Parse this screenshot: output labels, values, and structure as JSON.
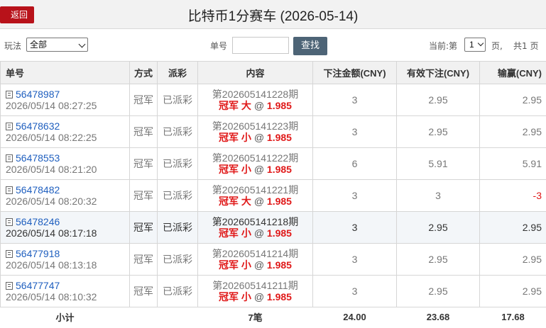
{
  "header": {
    "back_label": "返回",
    "title": "比特币1分赛车 (2026-05-14)"
  },
  "filter": {
    "play_label": "玩法",
    "play_selected": "全部",
    "order_label": "单号",
    "order_value": "",
    "search_label": "查找",
    "current_page_label": "当前:第",
    "current_page": "1",
    "page_unit": "页,",
    "total_pages": "共1 页"
  },
  "table": {
    "headers": {
      "order": "单号",
      "method": "方式",
      "payout": "派彩",
      "content": "内容",
      "bet_amount": "下注金额(CNY)",
      "valid_bet": "有效下注(CNY)",
      "win_loss": "输赢(CNY)"
    },
    "rows": [
      {
        "order_no": "56478987",
        "time": "2026/05/14 08:27:25",
        "method": "冠军",
        "payout": "已派彩",
        "issue": "第202605141228期",
        "bet": "冠军 大",
        "at": "@",
        "odds": "1.985",
        "amount": "3",
        "valid": "2.95",
        "win": "2.95"
      },
      {
        "order_no": "56478632",
        "time": "2026/05/14 08:22:25",
        "method": "冠军",
        "payout": "已派彩",
        "issue": "第202605141223期",
        "bet": "冠军 小",
        "at": "@",
        "odds": "1.985",
        "amount": "3",
        "valid": "2.95",
        "win": "2.95"
      },
      {
        "order_no": "56478553",
        "time": "2026/05/14 08:21:20",
        "method": "冠军",
        "payout": "已派彩",
        "issue": "第202605141222期",
        "bet": "冠军 小",
        "at": "@",
        "odds": "1.985",
        "amount": "6",
        "valid": "5.91",
        "win": "5.91"
      },
      {
        "order_no": "56478482",
        "time": "2026/05/14 08:20:32",
        "method": "冠军",
        "payout": "已派彩",
        "issue": "第202605141221期",
        "bet": "冠军 大",
        "at": "@",
        "odds": "1.985",
        "amount": "3",
        "valid": "3",
        "win": "-3"
      },
      {
        "order_no": "56478246",
        "time": "2026/05/14 08:17:18",
        "method": "冠军",
        "payout": "已派彩",
        "issue": "第202605141218期",
        "bet": "冠军 小",
        "at": "@",
        "odds": "1.985",
        "amount": "3",
        "valid": "2.95",
        "win": "2.95"
      },
      {
        "order_no": "56477918",
        "time": "2026/05/14 08:13:18",
        "method": "冠军",
        "payout": "已派彩",
        "issue": "第202605141214期",
        "bet": "冠军 小",
        "at": "@",
        "odds": "1.985",
        "amount": "3",
        "valid": "2.95",
        "win": "2.95"
      },
      {
        "order_no": "56477747",
        "time": "2026/05/14 08:10:32",
        "method": "冠军",
        "payout": "已派彩",
        "issue": "第202605141211期",
        "bet": "冠军 小",
        "at": "@",
        "odds": "1.985",
        "amount": "3",
        "valid": "2.95",
        "win": "2.95"
      }
    ],
    "footer": {
      "label": "小计",
      "count": "7笔",
      "bet_total": "24.00",
      "valid_total": "23.68",
      "win_total": "17.68"
    }
  },
  "colors": {
    "back_button": "#b8121a",
    "search_button": "#4d6476",
    "link_blue": "#1f5fbf",
    "bet_red": "#e01919"
  },
  "icons": {
    "row_icon": "document-icon",
    "select_arrow": "chevron-down-icon"
  }
}
